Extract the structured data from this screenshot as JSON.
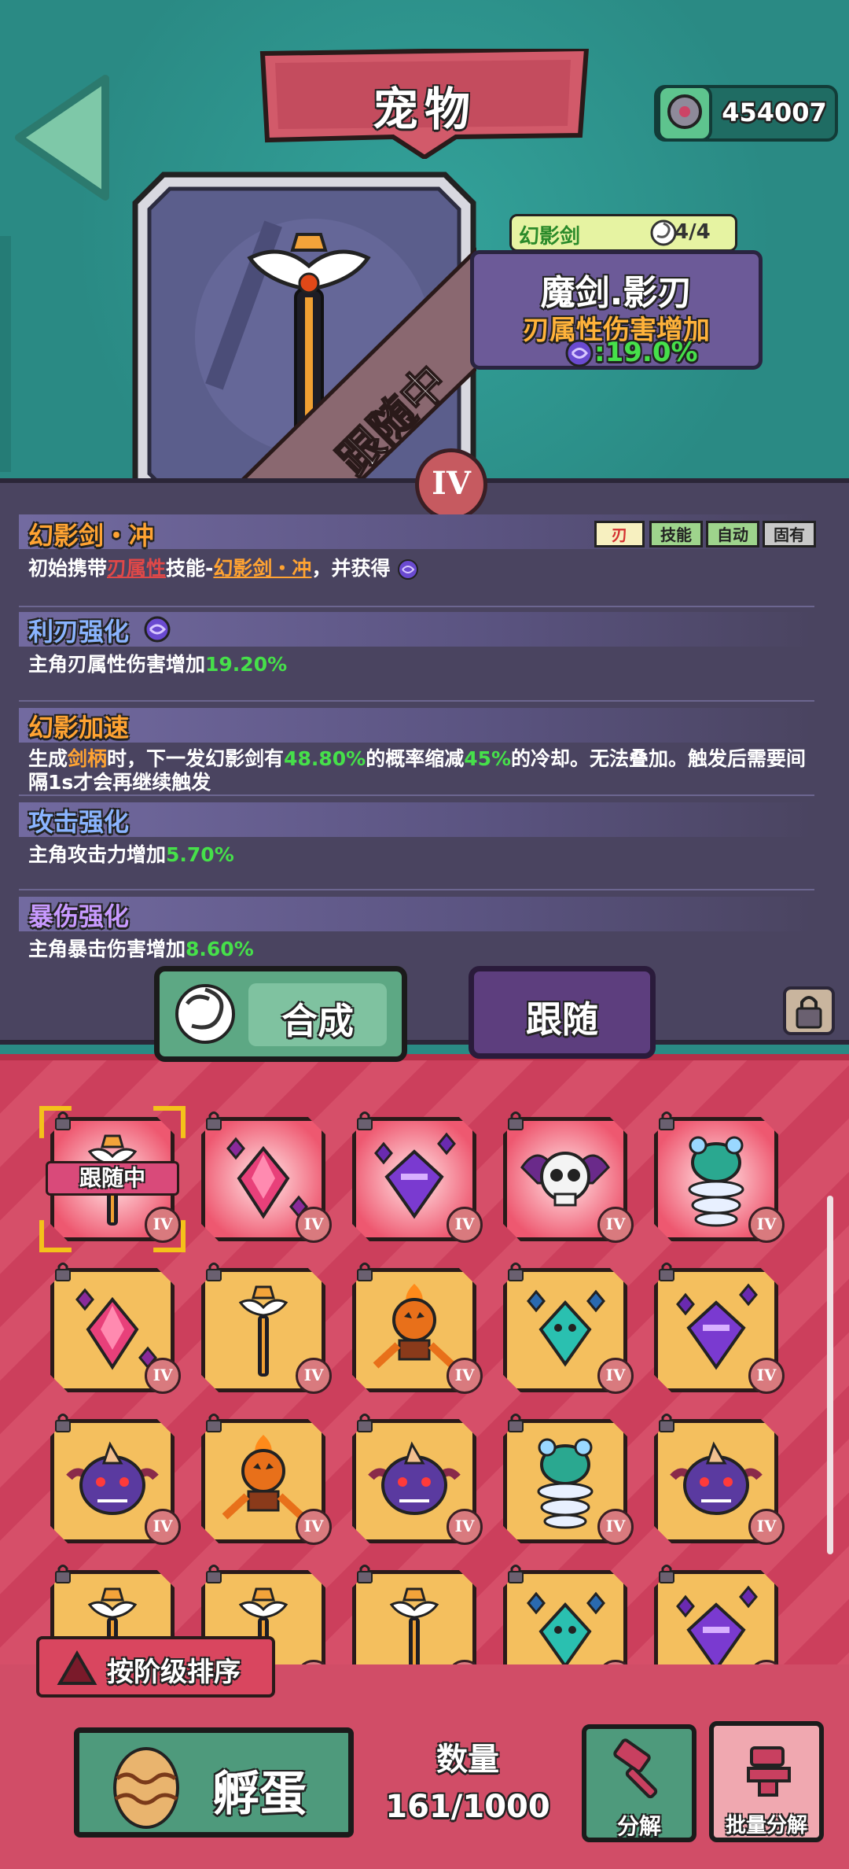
{
  "header": {
    "title": "宠物",
    "currency_value": "454007"
  },
  "pet": {
    "type_name": "幻影剑",
    "type_count": "4/4",
    "name": "魔剑.影刃",
    "effect": "刃属性伤害增加",
    "effect_value": ":19.0%",
    "status_ribbon": "跟随中",
    "grade": "IV"
  },
  "skills": {
    "tags": [
      "刃",
      "技能",
      "自动",
      "固有"
    ],
    "s1": {
      "title": "幻影剑・冲",
      "t1": "初始携带",
      "t2": "刃属性",
      "t3": "技能-",
      "t4": "幻影剑・冲",
      "t5": "，并获得"
    },
    "s2": {
      "title": "利刃强化",
      "t1": "主角刃属性伤害增加",
      "v": "19.20%"
    },
    "s3": {
      "title": "幻影加速",
      "t1": "生成",
      "t2": "剑柄",
      "t3": "时，下一发幻影剑有",
      "v1": "48.80%",
      "t4": "的概率缩减",
      "v2": "45%",
      "t5": "的冷却。无法叠加。触发后需要间隔1s才会再继续触发"
    },
    "s4": {
      "title": "攻击强化",
      "t1": "主角攻击力增加",
      "v": "5.70%"
    },
    "s5": {
      "title": "暴伤强化",
      "t1": "主角暴击伤害增加",
      "v": "8.60%"
    }
  },
  "actions": {
    "synthesize": "合成",
    "follow": "跟随"
  },
  "grid": {
    "following_label": "跟随中",
    "grade": "IV",
    "items": [
      "sword",
      "pink-crystal",
      "purple-crystal",
      "skull-bat",
      "teal-spring",
      "pink-crystal",
      "sword",
      "pumpkin-robot",
      "teal-crystal",
      "purple-crystal",
      "purple-horn-monster",
      "pumpkin-robot",
      "purple-horn-monster",
      "teal-spring",
      "purple-horn-monster",
      "sword",
      "sword",
      "sword",
      "teal-crystal",
      "purple-crystal"
    ]
  },
  "bottom": {
    "sort_label": "按阶级排序",
    "hatch_label": "孵蛋",
    "count_title": "数量",
    "count_value": "161/1000",
    "decompose_label": "分解",
    "batch_decompose_label": "批量分解"
  },
  "colors": {
    "teal_bg": "#2a8a84",
    "panel": "#4a4460",
    "grid_bg": "#cc3f5c",
    "accent_green": "#46e04a",
    "accent_orange": "#ffa332"
  }
}
